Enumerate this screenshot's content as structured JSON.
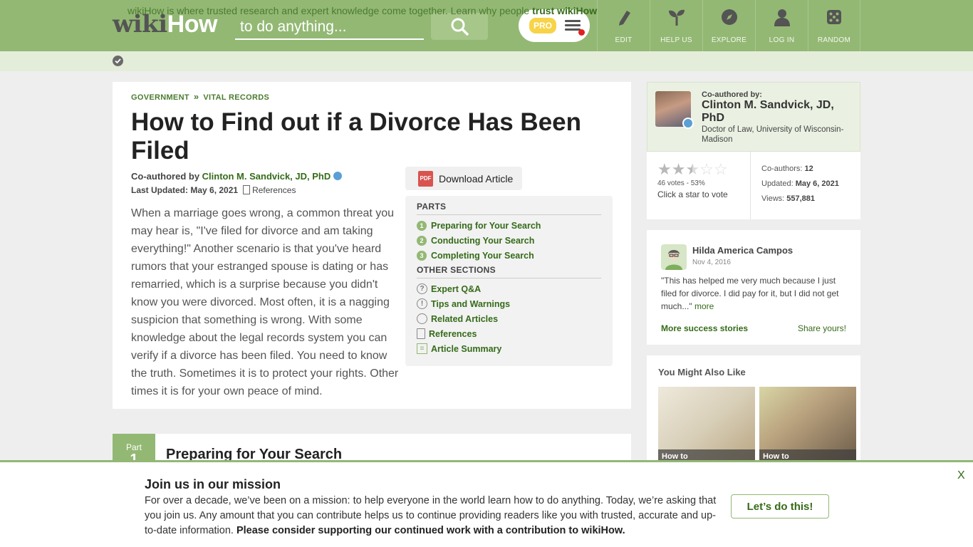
{
  "header": {
    "logo_wiki": "wiki",
    "logo_how": "How",
    "search_placeholder": "to do anything...",
    "pro_badge": "PRO",
    "nav": [
      {
        "label": "EDIT",
        "icon": "pencil-icon"
      },
      {
        "label": "HELP US",
        "icon": "sprout-icon"
      },
      {
        "label": "EXPLORE",
        "icon": "compass-icon"
      },
      {
        "label": "LOG IN",
        "icon": "user-icon"
      },
      {
        "label": "RANDOM",
        "icon": "dice-icon"
      }
    ]
  },
  "trust_bar": {
    "text": "wikiHow is where trusted research and expert knowledge come together. Learn why people ",
    "link": "trust wikiHow"
  },
  "article": {
    "breadcrumb": [
      "GOVERNMENT",
      "»",
      "VITAL RECORDS"
    ],
    "title": "How to Find out if a Divorce Has Been Filed",
    "byline_prefix": "Co-authored by ",
    "author": "Clinton M. Sandvick, JD, PhD",
    "updated_label": "Last Updated:",
    "updated_date": "May 6, 2021",
    "references_label": "References",
    "intro": "When a marriage goes wrong, a common threat you may hear is, \"I've filed for divorce and am taking everything!\" Another scenario is that you've heard rumors that your estranged spouse is dating or has remarried, which is a surprise because you didn't know you were divorced. Most often, it is a nagging suspicion that something is wrong. With some knowledge about the legal records system you can verify if a divorce has been filed. You need to know the truth. Sometimes it is to protect your rights. Other times it is for your own peace of mind.",
    "download_label": "Download Article",
    "pdf_label": "PDF"
  },
  "toc": {
    "parts_heading": "PARTS",
    "parts": [
      {
        "num": "1",
        "label": "Preparing for Your Search"
      },
      {
        "num": "2",
        "label": "Conducting Your Search"
      },
      {
        "num": "3",
        "label": "Completing Your Search"
      }
    ],
    "other_heading": "OTHER SECTIONS",
    "other": [
      {
        "label": "Expert Q&A",
        "icon": "question-icon",
        "glyph": "?"
      },
      {
        "label": "Tips and Warnings",
        "icon": "exclamation-icon",
        "glyph": "!"
      },
      {
        "label": "Related Articles",
        "icon": "related-articles-icon",
        "glyph": ""
      },
      {
        "label": "References",
        "icon": "references-icon",
        "glyph": ""
      },
      {
        "label": "Article Summary",
        "icon": "summary-icon",
        "glyph": "≡"
      }
    ]
  },
  "part1": {
    "badge": "Part",
    "badge_num": "1",
    "title": "Preparing for Your Search"
  },
  "author_card": {
    "coauthored_label": "Co-authored by:",
    "name": "Clinton M. Sandvick, JD, PhD",
    "credential": "Doctor of Law, University of Wisconsin-Madison",
    "rating_stars": 2.5,
    "votes": "46 votes - 53%",
    "vote_hint": "Click a star to vote",
    "coauthors_label": "Co-authors:",
    "coauthors": "12",
    "updated_label": "Updated:",
    "updated": "May 6, 2021",
    "views_label": "Views:",
    "views": "557,881"
  },
  "success_story": {
    "name": "Hilda America Campos",
    "date": "Nov 4, 2016",
    "quote": "\"This has helped me very much because I just filed for divorce. I did pay for it, but I did not get much...\"",
    "more": "more",
    "more_stories": "More success stories",
    "share": "Share yours!"
  },
  "related": {
    "title": "You Might Also Like",
    "items": [
      {
        "label": "How to"
      },
      {
        "label": "How to"
      }
    ]
  },
  "banner": {
    "title": "Join us in our mission",
    "text": "For over a decade, we’ve been on a mission: to help everyone in the world learn how to do anything. Today, we’re asking that you join us. Any amount that you can contribute helps us to continue providing readers like you with trusted, accurate and up-to-date information. ",
    "text_bold": "Please consider supporting our continued work with a contribution to wikiHow.",
    "cta": "Let’s do this!",
    "close": "X"
  },
  "colors": {
    "brand_green": "#93b874",
    "link_green": "#356b19",
    "trust_bar": "#e4edda",
    "pro_yellow": "#f7d347"
  }
}
